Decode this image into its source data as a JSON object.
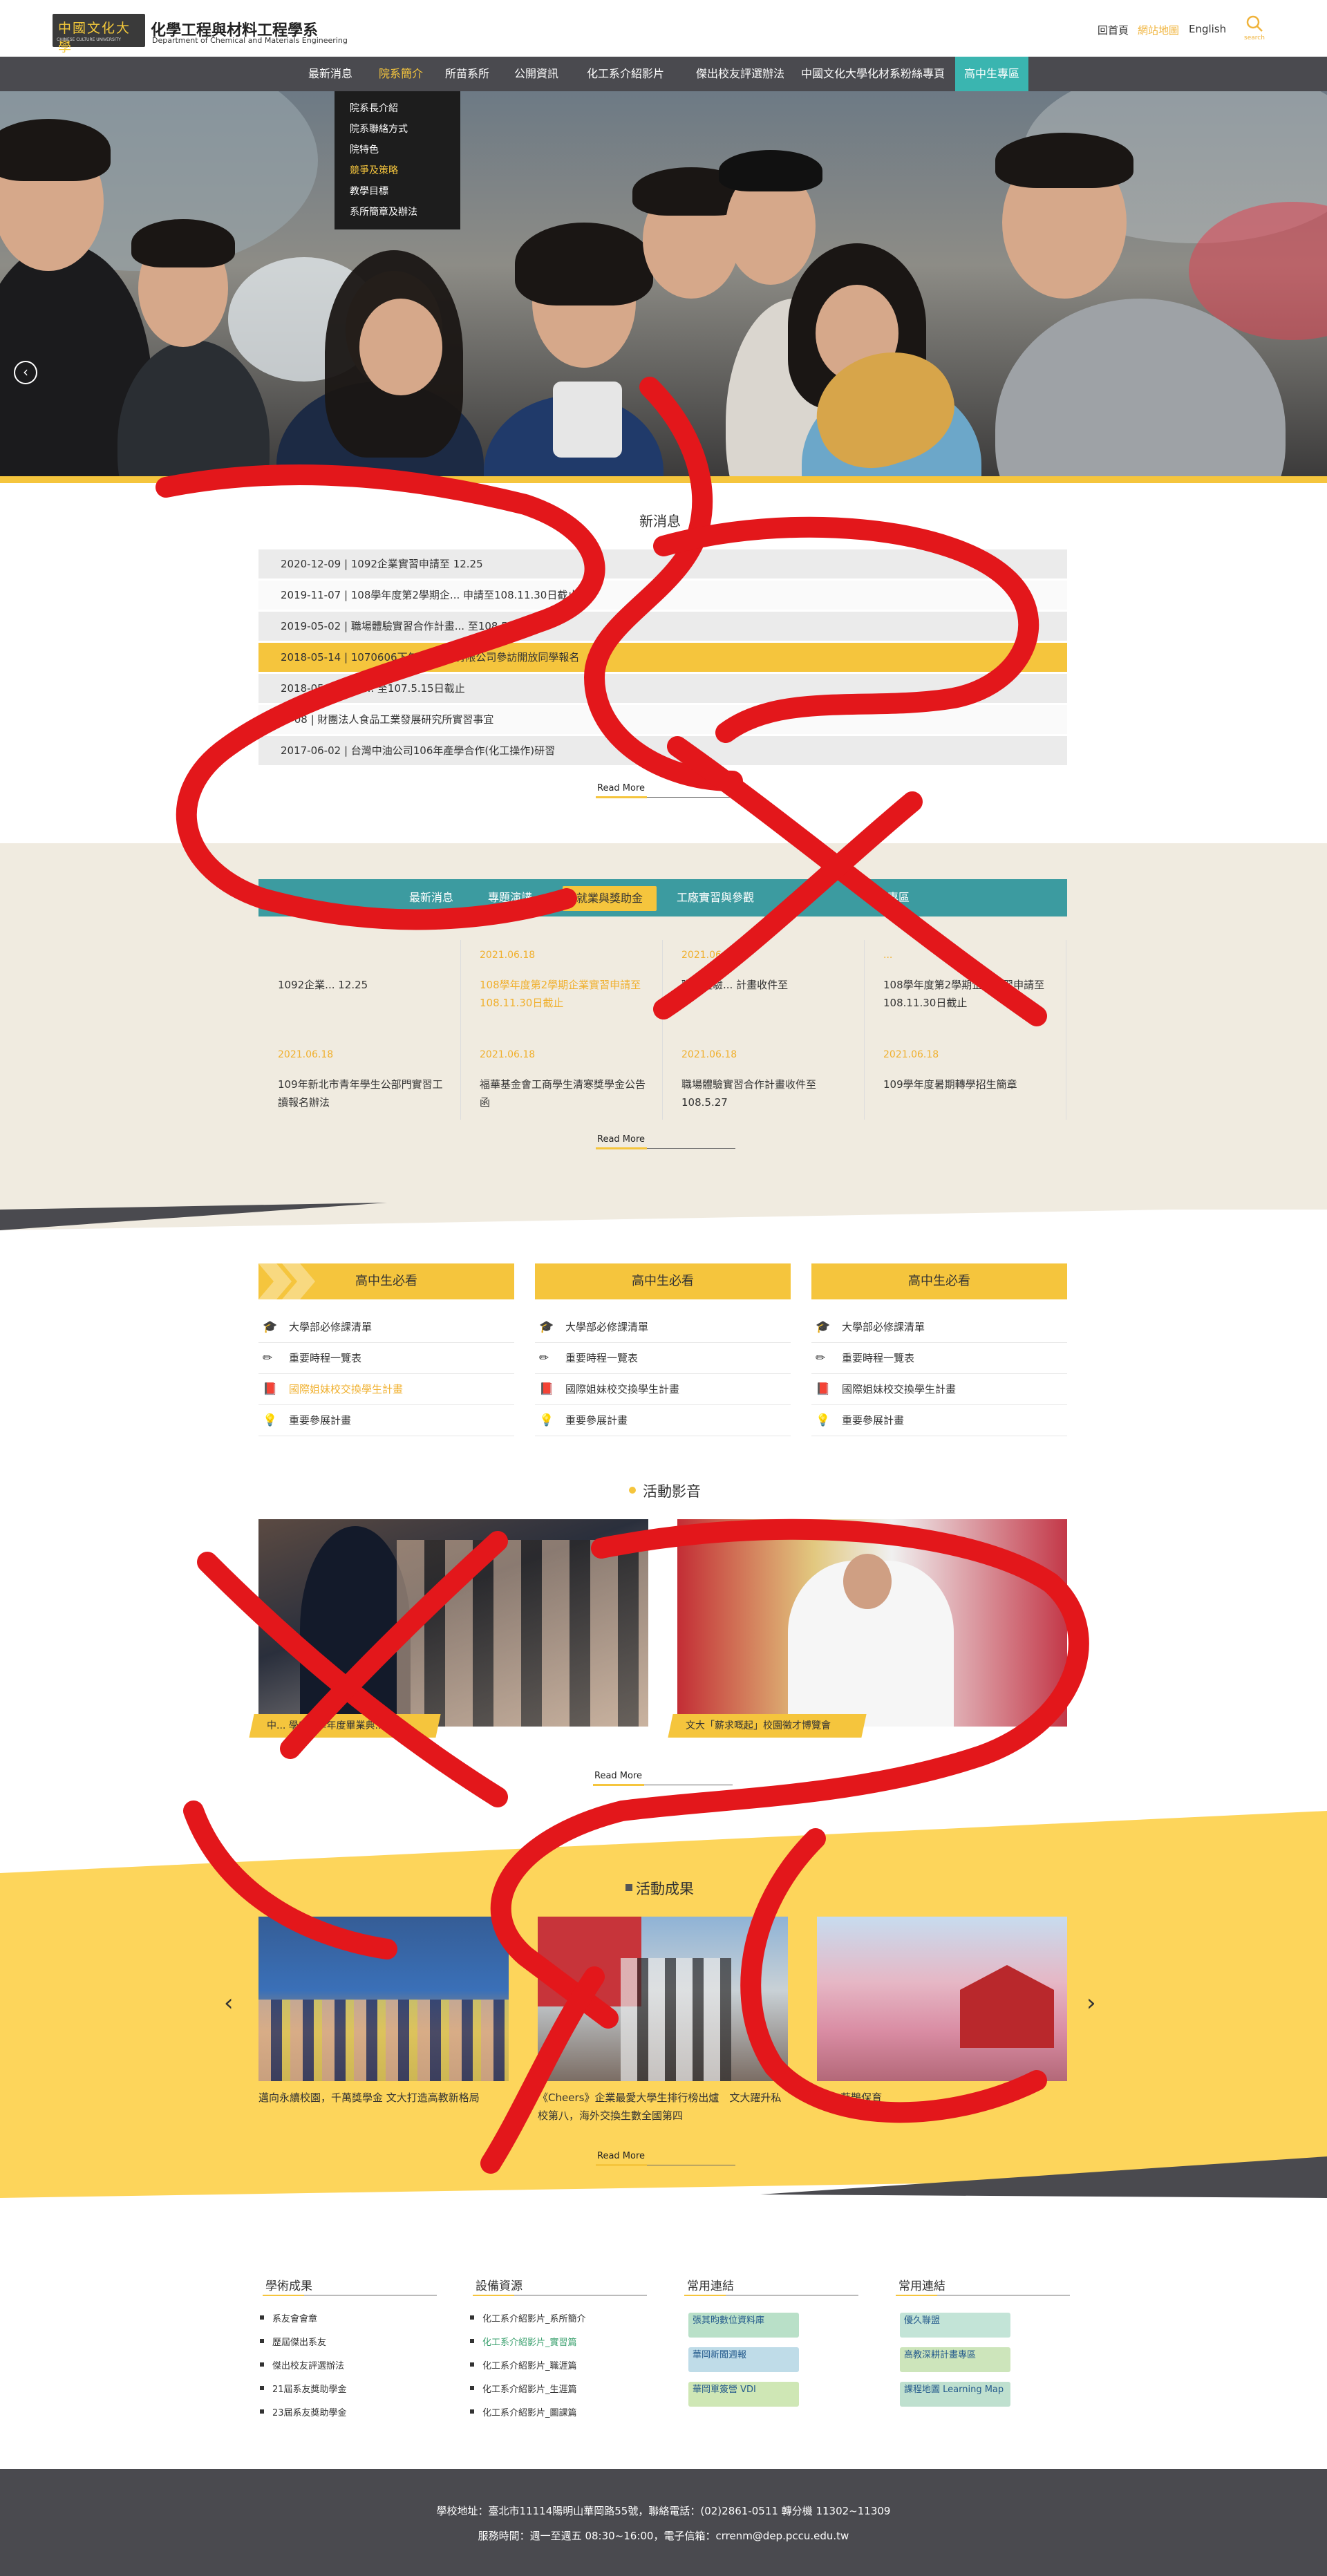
{
  "header": {
    "logo_text": "中國文化大學",
    "logo_sub": "CHINESE CULTURE UNIVERSITY",
    "site_title": "化學工程與材料工程學系",
    "site_subtitle": "Department of Chemical and Materials Engineering",
    "links": [
      "回首頁",
      "網站地圖",
      "English"
    ],
    "search_label": "search"
  },
  "nav": {
    "items": [
      "最新消息",
      "院系簡介",
      "所苗系所",
      "公開資訊",
      "化工系介紹影片",
      "傑出校友評選辦法",
      "中國文化大學化材系粉絲專頁",
      "高中生專區"
    ],
    "dropdown": [
      "院系長介紹",
      "院系聯絡方式",
      "院特色",
      "競爭及策略",
      "教學目標",
      "系所簡章及辦法"
    ]
  },
  "news": {
    "title": "新消息",
    "rows": [
      "2020-12-09  |  1092企業實習申請至 12.25",
      "2019-11-07  |  108學年度第2學期企... 申請至108.11.30日截止",
      "2019-05-02  |  職場體驗實習合作計畫... 至108.5.27",
      "2018-05-14  |  1070606下午 畢德... 有限公司參訪開放同學報名",
      "2018-05-04  |  10... 至107.5.15日截止",
      "...-08  |  財團法人食品工業發展研究所實習事宜",
      "2017-06-02  |  台灣中油公司106年產學合作(化工操作)研習"
    ],
    "read_more": "Read More"
  },
  "tabs": {
    "items": [
      "最新消息",
      "專題演講",
      "就業與獎助金",
      "工廠實習與參觀",
      "...",
      "家長專區"
    ],
    "cards": [
      {
        "date": "",
        "text": "1092企業... 12.25"
      },
      {
        "date": "2021.06.18",
        "text": "108學年度第2學期企業實習申請至108.11.30日截止"
      },
      {
        "date": "2021.06.18",
        "text": "職場體驗... 計畫收件至"
      },
      {
        "date": "...",
        "text": "108學年度第2學期企業實習申請至108.11.30日截止"
      },
      {
        "date": "2021.06.18",
        "text": "109年新北市青年學生公部門實習工讀報名辦法"
      },
      {
        "date": "2021.06.18",
        "text": "福華基金會工商學生清寒獎學金公告函"
      },
      {
        "date": "2021.06.18",
        "text": "職場體驗實習合作計畫收件至108.5.27"
      },
      {
        "date": "2021.06.18",
        "text": "109學年度暑期轉學招生簡章"
      }
    ],
    "read_more": "Read More"
  },
  "must_read": {
    "heading": "高中生必看",
    "items": [
      "大學部必修課清單",
      "重要時程一覽表",
      "國際姐妹校交換學生計畫",
      "重要參展計畫"
    ],
    "icons": [
      "graduation-cap-icon",
      "pencil-icon",
      "book-icon",
      "lightbulb-icon"
    ]
  },
  "videos": {
    "title": "活動影音",
    "items": [
      "中... 學109學年度畢業典...",
      "文大「薪求嘅起」校園徵才博覽會"
    ],
    "read_more": "Read More"
  },
  "achievements": {
    "title": "活動成果",
    "items": [
      "邁向永續校園，千萬獎學金 文大打造高教新格局",
      "《Cheers》企業最愛大學生排行榜出爐　文大躍升私校第八，海外交換生數全國第四",
      "文... 藍鵲保育"
    ],
    "read_more": "Read More"
  },
  "footer_links": {
    "cols": [
      {
        "title": "學術成果",
        "items": [
          "系友會會章",
          "歷屆傑出系友",
          "傑出校友評選辦法",
          "21屆系友獎助學金",
          "23屆系友獎助學金"
        ]
      },
      {
        "title": "設備資源",
        "items": [
          "化工系介紹影片_系所簡介",
          "化工系介紹影片_實習篇",
          "化工系介紹影片_職涯篇",
          "化工系介紹影片_生涯篇",
          "化工系介紹影片_圖課篇"
        ]
      },
      {
        "title": "常用連結",
        "items": [
          "張其昀數位資料庫",
          "華岡新聞週報",
          "華岡單簽營 VDI"
        ]
      },
      {
        "title": "常用連結",
        "items": [
          "優久聯盟",
          "高教深耕計畫專區",
          "課程地圖 Learning Map"
        ]
      }
    ]
  },
  "footer": {
    "line1": "學校地址：臺北市11114陽明山華岡路55號，聯絡電話：(02)2861-0511 轉分機 11302~11309",
    "line2": "服務時間：週一至週五 08:30~16:00，電子信箱：crrenm@dep.pccu.edu.tw"
  },
  "colors": {
    "accent": "#f5c53d",
    "teal": "#3c9ba0",
    "nav_bg": "#4a4a4f",
    "scribble": "#e3171b"
  }
}
